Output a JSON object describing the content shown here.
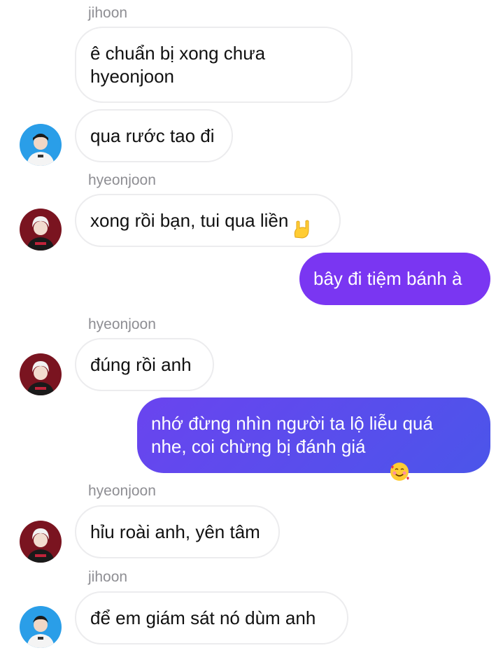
{
  "messages": [
    {
      "sender": "jihoon",
      "text": "ê chuẩn bị xong chưa\nhyeonjoon"
    },
    {
      "text": "qua rước tao đi"
    },
    {
      "sender": "hyeonjoon",
      "text": "xong rồi bạn, tui qua liền"
    },
    {
      "text": "bây đi tiệm bánh à"
    },
    {
      "sender": "hyeonjoon",
      "text": "đúng rồi anh"
    },
    {
      "text": "nhớ đừng nhìn người ta lộ liễu quá\nnhe, coi chừng bị đánh giá"
    },
    {
      "sender": "hyeonjoon",
      "text": "hỉu roài anh, yên tâm"
    },
    {
      "sender": "jihoon",
      "text": "để em giám sát nó dùm anh"
    }
  ],
  "emojis": {
    "msg3": "sign-of-horns-emoji",
    "msg6": "smiling-face-with-hearts-emoji"
  },
  "avatars": {
    "jihoon": "blue-background-portrait",
    "hyeonjoon": "red-background-portrait"
  },
  "colors": {
    "outgoing_gradient_start": "#7a36f2",
    "outgoing_gradient_end": "#4b55ea",
    "incoming_border": "#ececee",
    "sender_label": "#8e8e93"
  }
}
